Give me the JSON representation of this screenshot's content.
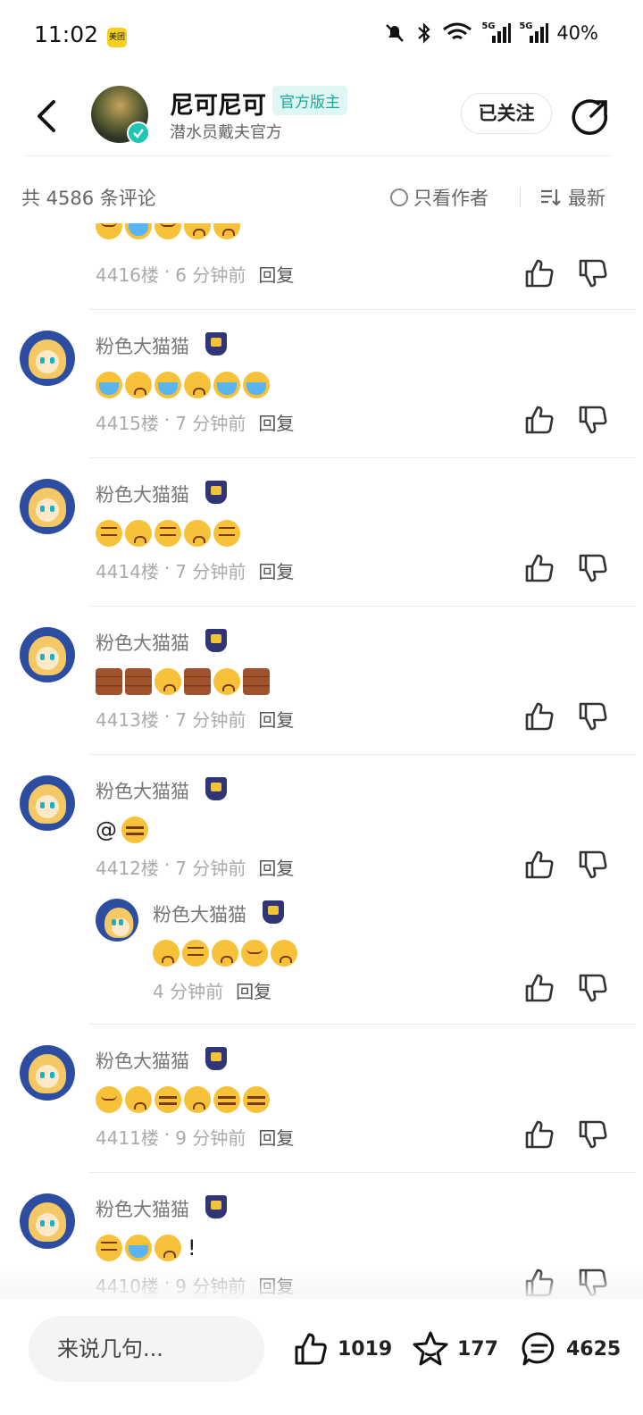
{
  "status_bar": {
    "time": "11:02",
    "app_badge": "美团",
    "network_1": "5G",
    "network_2": "5G",
    "battery": "40%"
  },
  "header": {
    "author_name": "尼可尼可",
    "author_tag": "官方版主",
    "author_subtitle": "潜水员戴夫官方",
    "follow_label": "已关注"
  },
  "subheader": {
    "comment_count": "共 4586 条评论",
    "author_only_label": "只看作者",
    "sort_label": "最新"
  },
  "comments": [
    {
      "floor": "4416楼",
      "time": "6 分钟前",
      "reply": "回复",
      "emojis": [
        "relieved",
        "cry",
        "relieved",
        "sad",
        "sad"
      ]
    },
    {
      "user": "粉色大猫猫",
      "floor": "4415楼",
      "time": "7 分钟前",
      "reply": "回复",
      "emojis": [
        "cry",
        "sad",
        "cry",
        "sad",
        "cry",
        "cry"
      ]
    },
    {
      "user": "粉色大猫猫",
      "floor": "4414楼",
      "time": "7 分钟前",
      "reply": "回复",
      "emojis": [
        "dizzy",
        "sad",
        "dizzy",
        "sad",
        "dizzy"
      ]
    },
    {
      "user": "粉色大猫猫",
      "floor": "4413楼",
      "time": "7 分钟前",
      "reply": "回复",
      "emojis": [
        "wall",
        "wall",
        "sad",
        "wall",
        "sad",
        "wall"
      ]
    },
    {
      "user": "粉色大猫猫",
      "floor": "4412楼",
      "time": "7 分钟前",
      "reply": "回复",
      "prefix": "@",
      "emojis": [
        "sly"
      ],
      "reply_comment": {
        "user": "粉色大猫猫",
        "time": "4 分钟前",
        "reply": "回复",
        "emojis": [
          "sad",
          "dizzy",
          "sad",
          "relieved",
          "sad"
        ]
      }
    },
    {
      "user": "粉色大猫猫",
      "floor": "4411楼",
      "time": "9 分钟前",
      "reply": "回复",
      "emojis": [
        "relieved",
        "sad",
        "sly",
        "sad",
        "sly",
        "sly"
      ]
    },
    {
      "user": "粉色大猫猫",
      "floor": "4410楼",
      "time": "9 分钟前",
      "reply": "回复",
      "emojis": [
        "dizzy",
        "cry",
        "sad"
      ],
      "suffix": "!"
    }
  ],
  "bottom_bar": {
    "input_placeholder": "来说几句...",
    "likes": "1019",
    "favorites": "177",
    "comments": "4625"
  },
  "colors": {
    "accent": "#1aa89b",
    "emoji": "#f7c23a",
    "badge": "#2f3576"
  }
}
